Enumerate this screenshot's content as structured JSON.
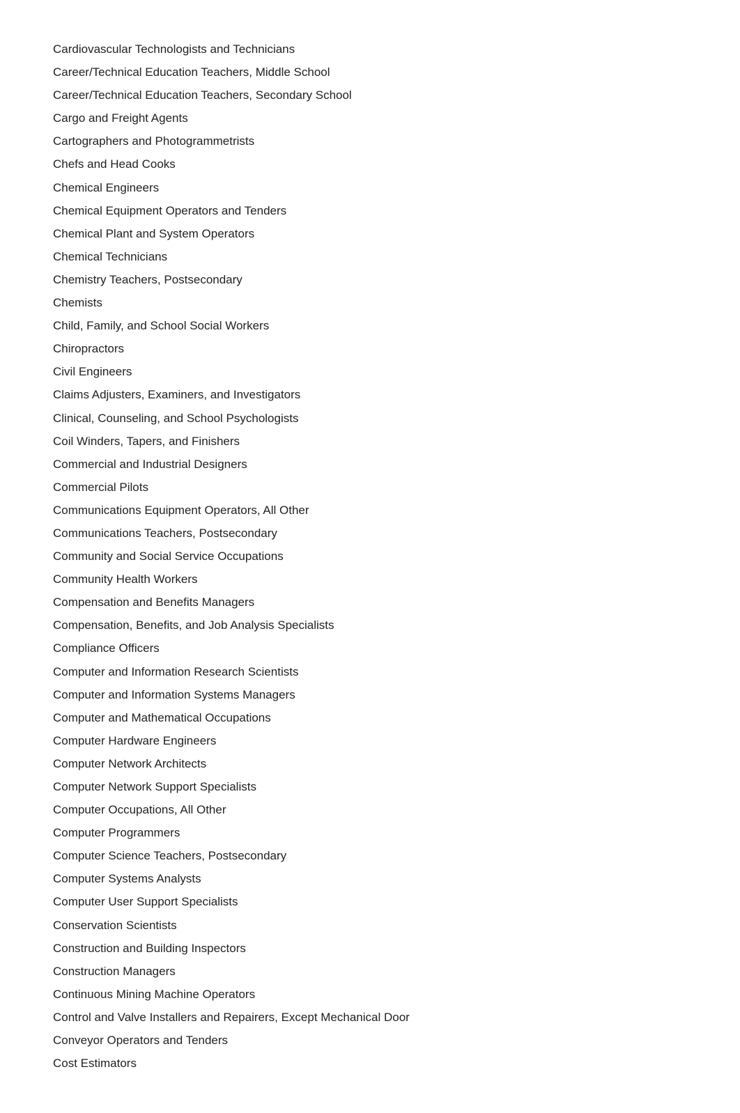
{
  "occupations": [
    "Cardiovascular Technologists and Technicians",
    "Career/Technical Education Teachers, Middle School",
    "Career/Technical Education Teachers, Secondary School",
    "Cargo and Freight Agents",
    "Cartographers and Photogrammetrists",
    "Chefs and Head Cooks",
    "Chemical Engineers",
    "Chemical Equipment Operators and Tenders",
    "Chemical Plant and System Operators",
    "Chemical Technicians",
    "Chemistry Teachers, Postsecondary",
    "Chemists",
    "Child, Family, and School Social Workers",
    "Chiropractors",
    "Civil Engineers",
    "Claims Adjusters, Examiners, and Investigators",
    "Clinical, Counseling, and School Psychologists",
    "Coil Winders, Tapers, and Finishers",
    "Commercial and Industrial Designers",
    "Commercial Pilots",
    "Communications Equipment Operators, All Other",
    "Communications Teachers, Postsecondary",
    "Community and Social Service Occupations",
    "Community Health Workers",
    "Compensation and Benefits Managers",
    "Compensation, Benefits, and Job Analysis Specialists",
    "Compliance Officers",
    "Computer and Information Research Scientists",
    "Computer and Information Systems Managers",
    "Computer and Mathematical Occupations",
    "Computer Hardware Engineers",
    "Computer Network Architects",
    "Computer Network Support Specialists",
    "Computer Occupations, All Other",
    "Computer Programmers",
    "Computer Science Teachers, Postsecondary",
    "Computer Systems Analysts",
    "Computer User Support Specialists",
    "Conservation Scientists",
    "Construction and Building Inspectors",
    "Construction Managers",
    "Continuous Mining Machine Operators",
    "Control and Valve Installers and Repairers, Except Mechanical Door",
    "Conveyor Operators and Tenders",
    "Cost Estimators"
  ]
}
